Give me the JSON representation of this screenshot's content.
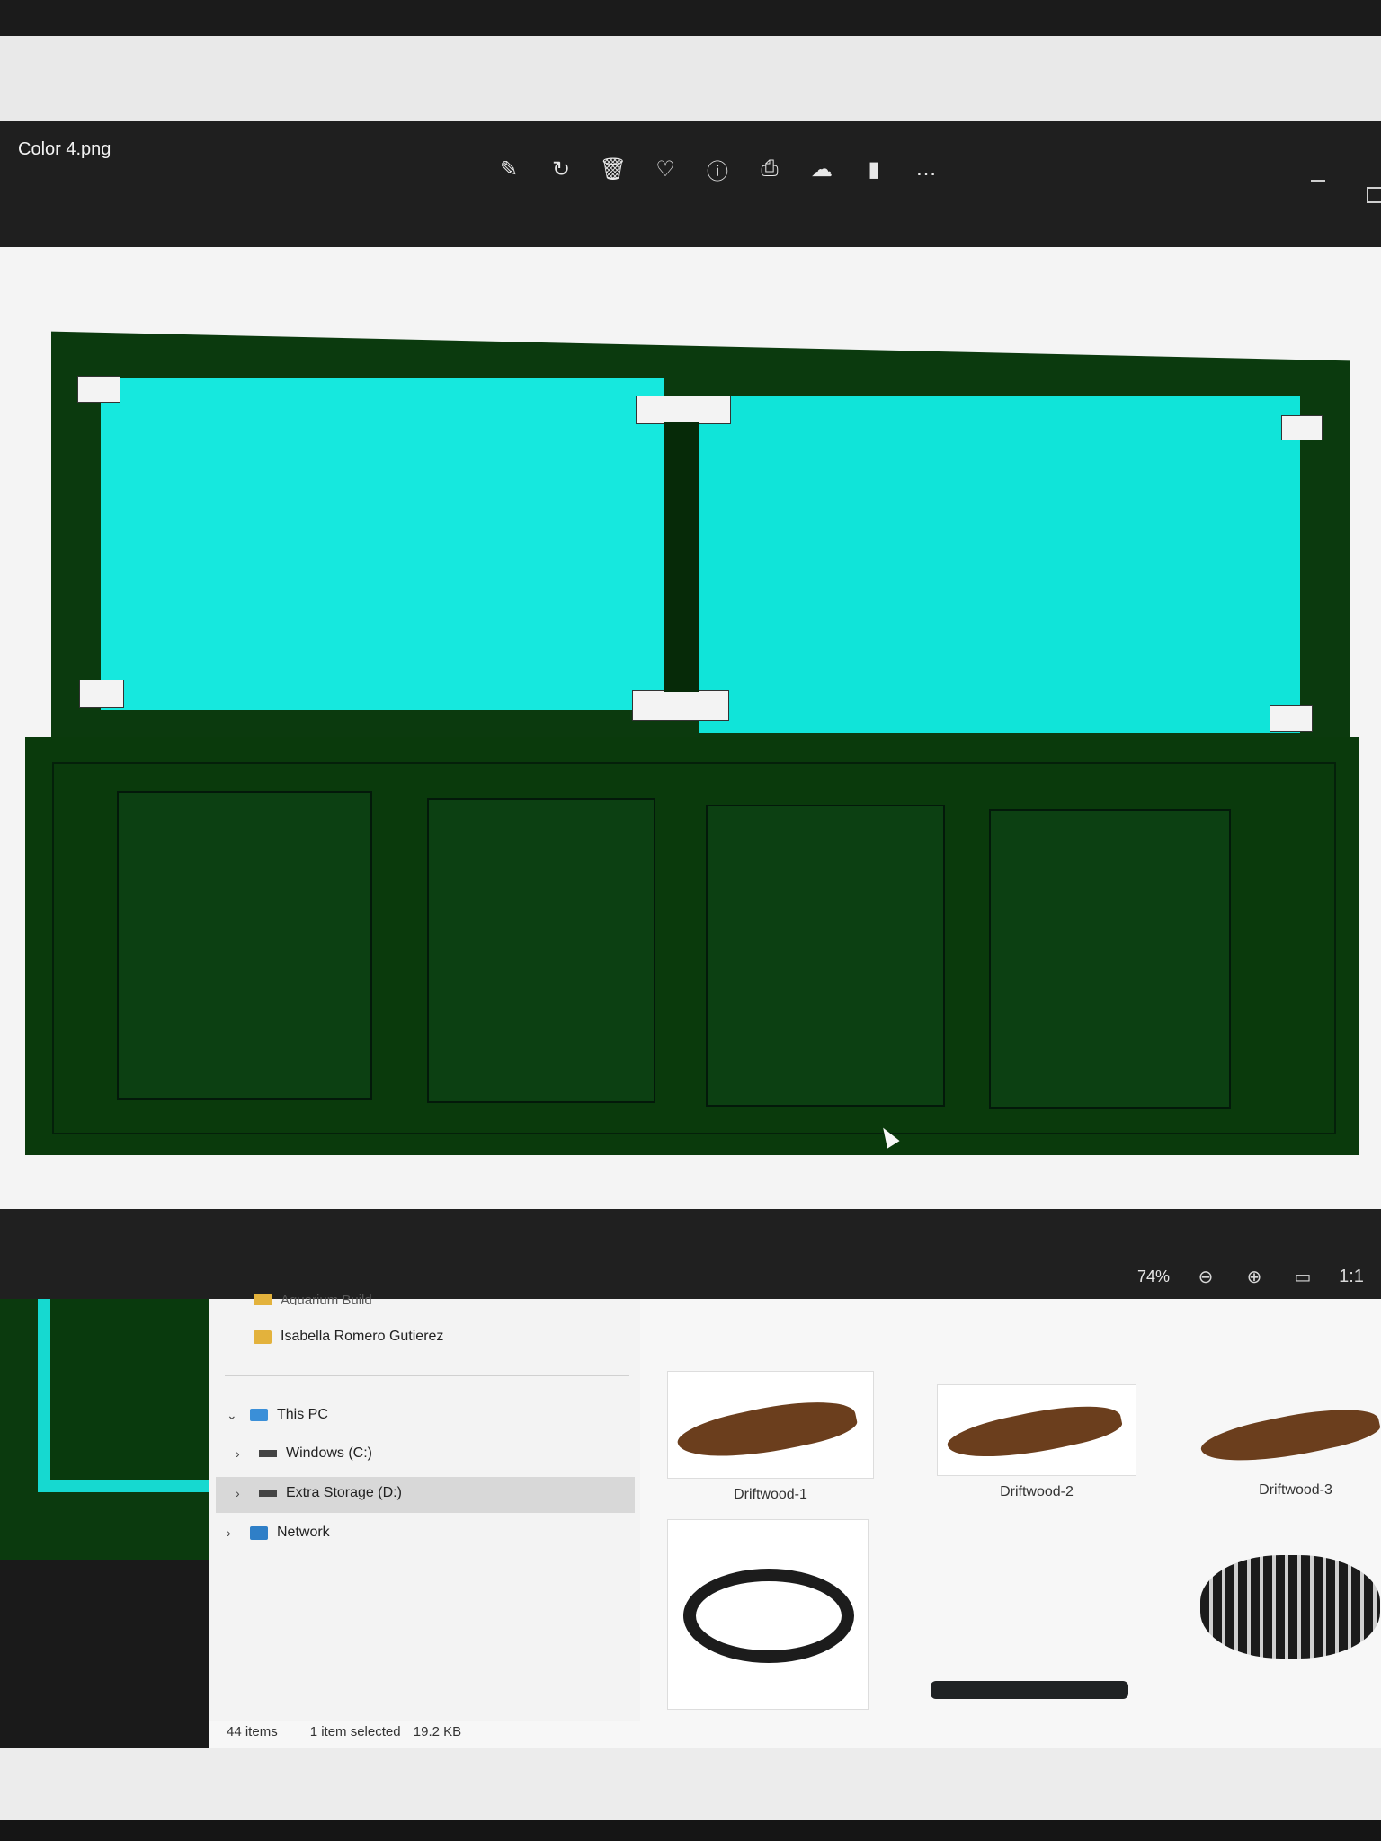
{
  "viewer": {
    "file_title": "Color 4.png",
    "toolbar": [
      {
        "name": "edit-image-icon",
        "glyph": "✎"
      },
      {
        "name": "rotate-icon",
        "glyph": "↻"
      },
      {
        "name": "delete-icon",
        "glyph": "🗑"
      },
      {
        "name": "favorite-icon",
        "glyph": "♡"
      },
      {
        "name": "info-icon",
        "glyph": "ⓘ"
      },
      {
        "name": "print-icon",
        "glyph": "⎙"
      },
      {
        "name": "onedrive-icon",
        "glyph": "☁"
      },
      {
        "name": "clipchamp-icon",
        "glyph": "▮"
      },
      {
        "name": "more-options-icon",
        "glyph": "…"
      }
    ],
    "zoom_level": "74%",
    "zoom_controls": [
      {
        "name": "zoom-out-icon",
        "glyph": "⊖"
      },
      {
        "name": "zoom-in-icon",
        "glyph": "⊕"
      },
      {
        "name": "fit-to-window-icon",
        "glyph": "▭"
      },
      {
        "name": "actual-size-icon",
        "glyph": "1:1"
      }
    ]
  },
  "colors": {
    "tank_frame": "#0b3a0e",
    "glass": "#16e8de",
    "stand": "#0a3a0c"
  },
  "explorer": {
    "nav": {
      "partial_folder": "Aquarium Build",
      "user_folder": "Isabella Romero Gutierez",
      "this_pc": "This PC",
      "drive_c": "Windows (C:)",
      "drive_d": "Extra Storage (D:)",
      "network": "Network"
    },
    "files": [
      {
        "label": "Driftwood-1"
      },
      {
        "label": "Driftwood-2"
      },
      {
        "label": "Driftwood-3"
      }
    ],
    "status": {
      "item_count": "44 items",
      "selection": "1 item selected",
      "size": "19.2 KB"
    }
  }
}
